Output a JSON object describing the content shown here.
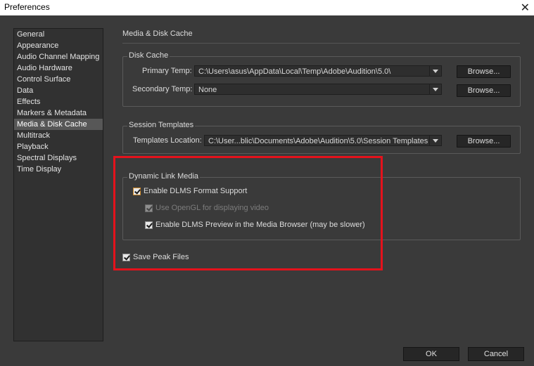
{
  "window": {
    "title": "Preferences",
    "close_glyph": "✕"
  },
  "sidebar": {
    "items": [
      {
        "label": "General"
      },
      {
        "label": "Appearance"
      },
      {
        "label": "Audio Channel Mapping"
      },
      {
        "label": "Audio Hardware"
      },
      {
        "label": "Control Surface"
      },
      {
        "label": "Data"
      },
      {
        "label": "Effects"
      },
      {
        "label": "Markers & Metadata"
      },
      {
        "label": "Media & Disk Cache",
        "selected": true
      },
      {
        "label": "Multitrack"
      },
      {
        "label": "Playback"
      },
      {
        "label": "Spectral Displays"
      },
      {
        "label": "Time Display"
      }
    ]
  },
  "main": {
    "section_title": "Media & Disk Cache",
    "disk_cache": {
      "label": "Disk Cache",
      "primary_label": "Primary Temp:",
      "primary_value": "C:\\Users\\asus\\AppData\\Local\\Temp\\Adobe\\Audition\\5.0\\",
      "secondary_label": "Secondary Temp:",
      "secondary_value": "None",
      "browse_label": "Browse..."
    },
    "session_templates": {
      "label": "Session Templates",
      "location_label": "Templates Location:",
      "location_value": "C:\\User...blic\\Documents\\Adobe\\Audition\\5.0\\Session Templates",
      "browse_label": "Browse..."
    },
    "dynamic_link": {
      "label": "Dynamic Link Media",
      "enable_dlms": {
        "label": "Enable DLMS Format Support",
        "checked": true
      },
      "use_opengl": {
        "label": "Use OpenGL for displaying video",
        "checked": true,
        "disabled": true
      },
      "enable_preview": {
        "label": "Enable DLMS Preview in the Media Browser (may be slower)",
        "checked": true
      }
    },
    "save_peak": {
      "label": "Save Peak Files",
      "checked": true
    }
  },
  "footer": {
    "ok_label": "OK",
    "cancel_label": "Cancel"
  },
  "colors": {
    "highlight": "#e4121c",
    "background": "#3a3a3a",
    "selected": "#575757"
  }
}
